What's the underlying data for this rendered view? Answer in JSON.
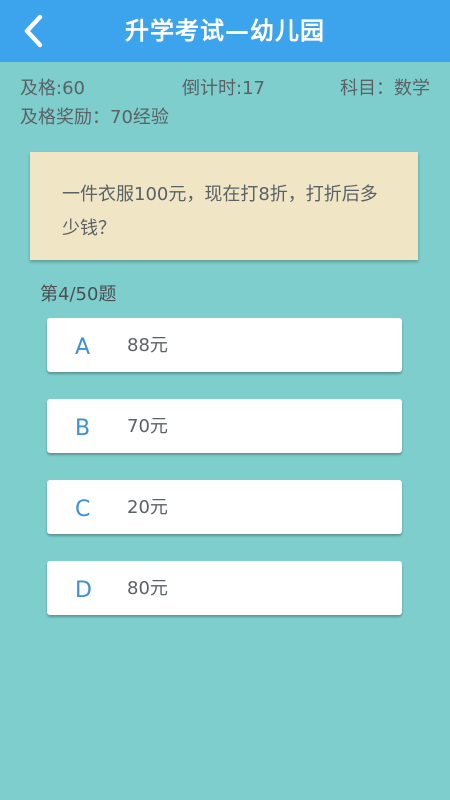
{
  "header": {
    "title": "升学考试—幼儿园",
    "back_icon": "chevron-left-icon"
  },
  "info": {
    "pass_score": "及格:60",
    "countdown": "倒计时:17",
    "subject": "科目：数学",
    "reward": "及格奖励：70经验"
  },
  "question": {
    "text": "一件衣服100元，现在打8折，打折后多少钱？"
  },
  "progress": "第4/50题",
  "options": [
    {
      "letter": "A",
      "text": "88元"
    },
    {
      "letter": "B",
      "text": "70元"
    },
    {
      "letter": "C",
      "text": "20元"
    },
    {
      "letter": "D",
      "text": "80元"
    }
  ],
  "colors": {
    "background": "#7ecece",
    "header": "#3ca3ed",
    "question_card": "#f0e5c4",
    "option_letter": "#3d8fd6"
  }
}
